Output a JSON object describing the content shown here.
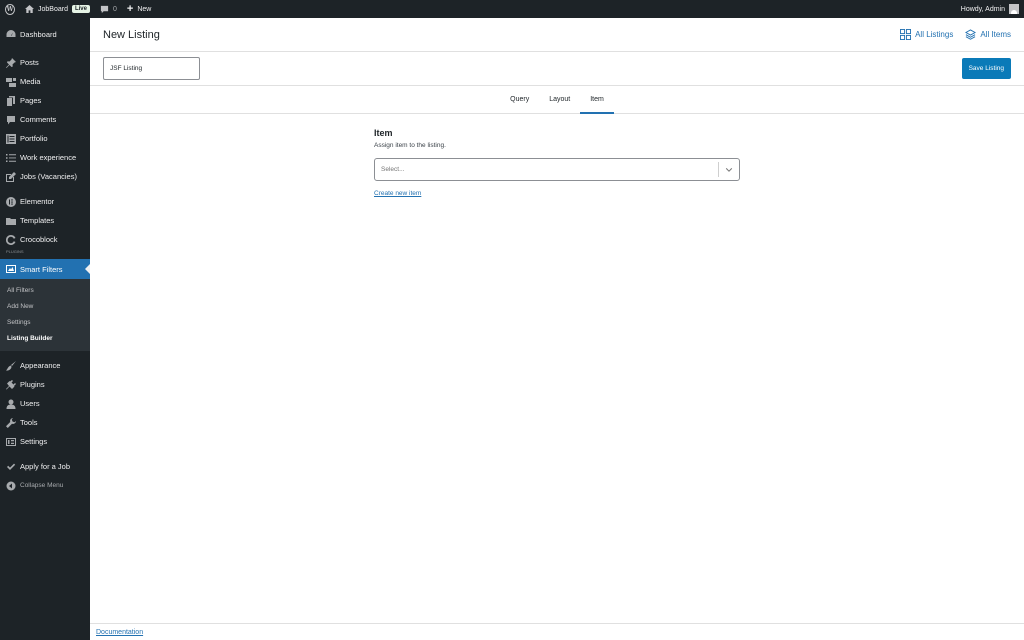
{
  "admin_bar": {
    "site_name": "JobBoard",
    "live_badge": "Live",
    "comments_count": "0",
    "new_label": "New",
    "greeting": "Howdy, Admin"
  },
  "sidebar": {
    "items": [
      {
        "label": "Dashboard",
        "icon": "dashboard-icon"
      },
      {
        "label": "Posts",
        "icon": "pin-icon"
      },
      {
        "label": "Media",
        "icon": "media-icon"
      },
      {
        "label": "Pages",
        "icon": "pages-icon"
      },
      {
        "label": "Comments",
        "icon": "comment-icon"
      },
      {
        "label": "Portfolio",
        "icon": "portfolio-icon"
      },
      {
        "label": "Work experience",
        "icon": "list-icon"
      },
      {
        "label": "Jobs (Vacancies)",
        "icon": "edit-icon"
      },
      {
        "label": "Elementor",
        "icon": "elementor-icon"
      },
      {
        "label": "Templates",
        "icon": "folder-icon"
      },
      {
        "label": "Crocoblock",
        "icon": "crocoblock-icon"
      },
      {
        "label": "Smart Filters",
        "icon": "filters-icon"
      },
      {
        "label": "Appearance",
        "icon": "brush-icon"
      },
      {
        "label": "Plugins",
        "icon": "plugin-icon"
      },
      {
        "label": "Users",
        "icon": "users-icon"
      },
      {
        "label": "Tools",
        "icon": "wrench-icon"
      },
      {
        "label": "Settings",
        "icon": "settings-icon"
      },
      {
        "label": "Apply for a Job",
        "icon": "check-icon"
      },
      {
        "label": "Collapse Menu",
        "icon": "collapse-icon"
      }
    ],
    "section_label": "PLUGINS",
    "submenu": [
      "All Filters",
      "Add New",
      "Settings",
      "Listing Builder"
    ]
  },
  "header": {
    "title": "New Listing",
    "links": [
      "All Listings",
      "All Items"
    ]
  },
  "listing": {
    "name_value": "JSF Listing",
    "save_label": "Save Listing"
  },
  "tabs": [
    "Query",
    "Layout",
    "Item"
  ],
  "active_tab": "Item",
  "panel": {
    "title": "Item",
    "description": "Assign item to the listing.",
    "select_placeholder": "Select...",
    "create_link": "Create new item"
  },
  "footer": {
    "documentation": "Documentation"
  },
  "colors": {
    "admin_dark": "#1d2327",
    "accent": "#2271b1",
    "button": "#0a7ab8"
  }
}
